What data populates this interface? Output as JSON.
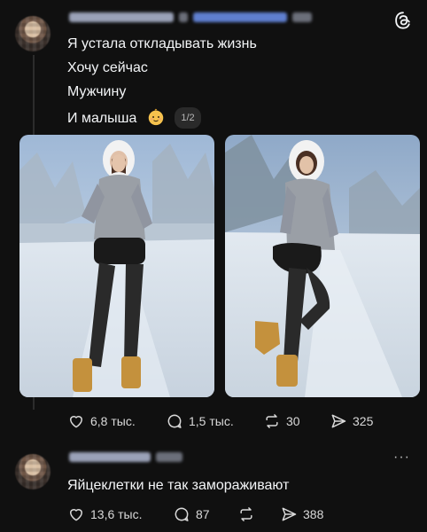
{
  "post": {
    "author_blurred": true,
    "lines": [
      "Я устала откладывать жизнь",
      "Хочу сейчас",
      "Мужчину",
      "И малыша"
    ],
    "emoji": "baby-face",
    "page_badge": "1/2",
    "actions": {
      "likes": "6,8 тыс.",
      "replies": "1,5 тыс.",
      "reposts": "30",
      "shares": "325"
    }
  },
  "reply": {
    "author_blurred": true,
    "text": "Яйцеклетки не так замораживают",
    "actions": {
      "likes": "13,6 тыс.",
      "replies": "87",
      "reposts": "",
      "shares": "388"
    }
  },
  "icons": {
    "logo": "threads-logo-icon",
    "more": "more-options-icon"
  },
  "colors": {
    "background": "#101010",
    "text": "#f3f5f7",
    "muted": "#d9d9d9"
  }
}
